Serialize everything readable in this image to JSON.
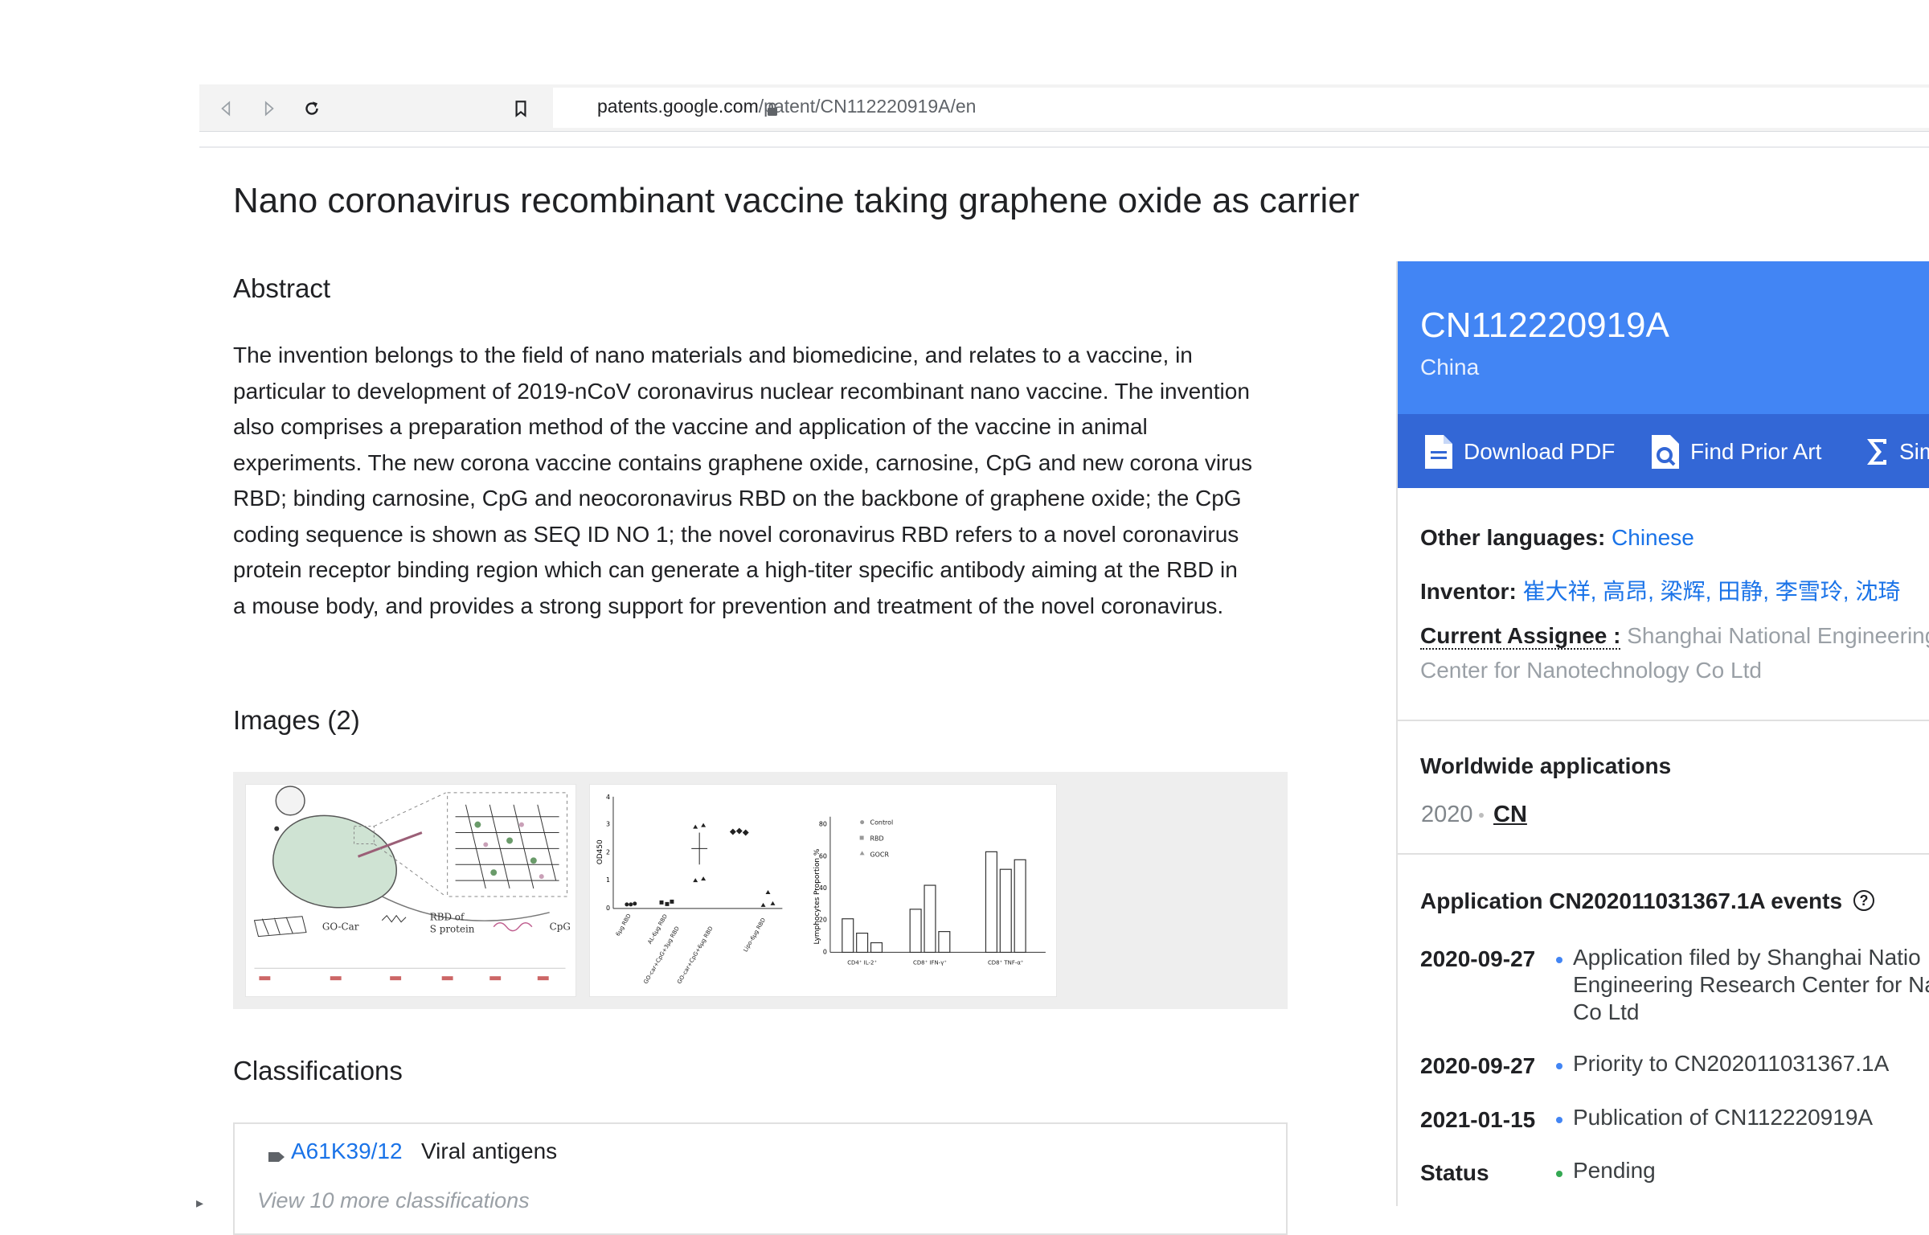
{
  "browser": {
    "url_domain": "patents.google.com",
    "url_path": "/patent/CN112220919A/en"
  },
  "title": "Nano coronavirus recombinant vaccine taking graphene oxide as carrier",
  "abstract": {
    "heading": "Abstract",
    "text": "The invention belongs to the field of nano materials and biomedicine, and relates to a vaccine, in particular to development of 2019-nCoV coronavirus nuclear recombinant nano vaccine. The invention also comprises a preparation method of the vaccine and application of the vaccine in animal experiments. The new corona vaccine contains graphene oxide, carnosine, CpG and new corona virus RBD; binding carnosine, CpG and neocoronavirus RBD on the backbone of graphene oxide; the CpG coding sequence is shown as SEQ ID NO 1; the novel coronavirus RBD refers to a novel coronavirus protein receptor binding region which can generate a high-titer specific antibody aiming at the RBD in a mouse body, and provides a strong support for prevention and treatment of the novel coronavirus."
  },
  "images": {
    "heading": "Images (2)",
    "figure1": {
      "labels": [
        "GO-Car",
        "RBD of",
        "S protein",
        "CpG"
      ]
    },
    "figure2": {
      "ylabel_left": "OD450",
      "xlabels_left": [
        "6μg RBD",
        "AL-6μg RBD",
        "GO-car+CpG+3μg RBD",
        "GO-car+CpG+6μg RBD",
        "Lipo-6μg RBD"
      ],
      "ylabel_right": "Lymphocytes Proportion %",
      "legend": [
        "Control",
        "RBD",
        "GOCR"
      ],
      "xlabels_right": [
        "CD4⁺ IL-2⁺",
        "CD8⁺ IFN-γ⁺",
        "CD8⁺ TNF-α⁺"
      ],
      "yticks_left": [
        "0",
        "1",
        "2",
        "3",
        "4"
      ],
      "yticks_right": [
        "0",
        "20",
        "40",
        "60",
        "80"
      ]
    }
  },
  "classifications": {
    "heading": "Classifications",
    "code": "A61K39/12",
    "description": "Viral antigens",
    "more": "View 10 more classifications"
  },
  "side": {
    "publication_number": "CN112220919A",
    "country": "China",
    "actions": [
      "Download PDF",
      "Find Prior Art",
      "Similar"
    ],
    "other_languages_label": "Other languages:",
    "other_languages_value": "Chinese",
    "inventor_label": "Inventor:",
    "inventors": "崔大祥, 高昂, 梁辉, 田静, 李雪玲, 沈琦",
    "assignee_label": "Current Assignee :",
    "assignee_line1": "Shanghai National Engineering",
    "assignee_line2": "Center for Nanotechnology Co Ltd",
    "worldwide_heading": "Worldwide applications",
    "worldwide_year": "2020",
    "worldwide_country": "CN",
    "events_heading": "Application CN202011031367.1A events",
    "events": [
      {
        "date": "2020-09-27",
        "lines": [
          "Application filed by Shanghai Natio",
          "Engineering Research Center for Na",
          "Co Ltd"
        ],
        "dot": "#4285f4"
      },
      {
        "date": "2020-09-27",
        "lines": [
          "Priority to CN202011031367.1A"
        ],
        "dot": "#4285f4"
      },
      {
        "date": "2021-01-15",
        "lines": [
          "Publication of CN112220919A"
        ],
        "dot": "#4285f4"
      },
      {
        "date": "Status",
        "lines": [
          "Pending"
        ],
        "dot": "#34a853"
      }
    ]
  },
  "colors": {
    "accent": "#4285f4",
    "accent_dark": "#3367d6",
    "link": "#1a73e8"
  }
}
